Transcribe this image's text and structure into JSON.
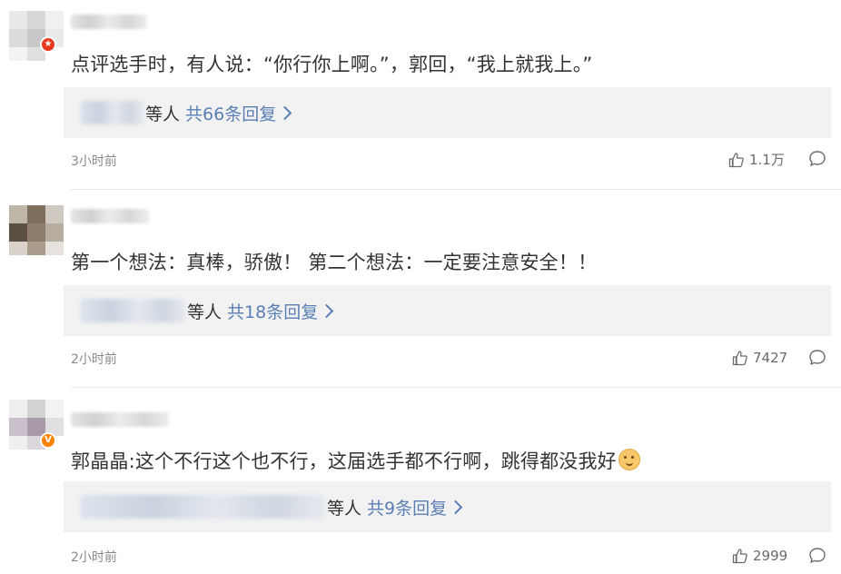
{
  "comments": [
    {
      "text": "点评选手时，有人说：“你行你上啊。”，郭回，“我上就我上。”",
      "reply_etc": "等人",
      "reply_count": "共66条回复",
      "time": "3小时前",
      "likes": "1.1万",
      "badge_icon": "red-star-badge-icon"
    },
    {
      "text": "第一个想法：真棒，骄傲！ 第二个想法：一定要注意安全！！",
      "reply_etc": "等人",
      "reply_count": "共18条回复",
      "time": "2小时前",
      "likes": "7427"
    },
    {
      "text": "郭晶晶:这个不行这个也不行，这届选手都不行啊，跳得都没我好",
      "emoji": "doge-emoji",
      "reply_etc": "等人",
      "reply_count": "共9条回复",
      "time": "2小时前",
      "likes": "2999",
      "badge_icon": "vip-badge-icon",
      "badge_text": "V"
    }
  ]
}
